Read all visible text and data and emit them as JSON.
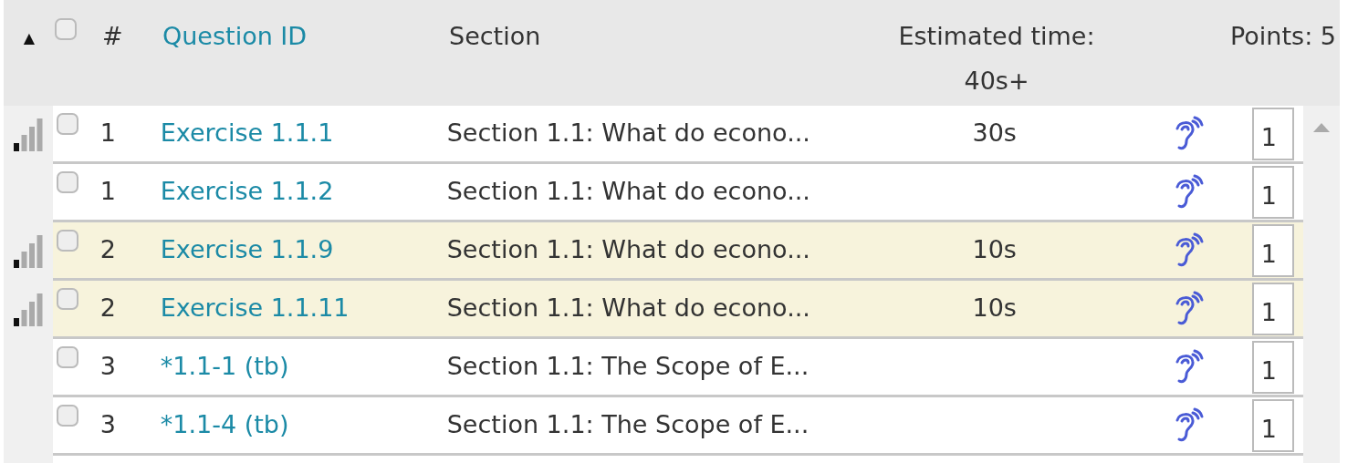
{
  "header": {
    "sort_indicator": "▲",
    "select_all_checked": false,
    "number": "#",
    "question_id": "Question ID",
    "section": "Section",
    "estimated_time": "Estimated time:",
    "estimated_total": "40s+",
    "points": "Points: 5"
  },
  "rows": [
    {
      "level": 0.25,
      "checked": false,
      "number": "1",
      "question_id": "Exercise 1.1.1",
      "section": "Section 1.1: What do econo...",
      "time": "30s",
      "points": "1",
      "highlighted": false
    },
    {
      "checked": false,
      "number": "1",
      "question_id": "Exercise 1.1.2",
      "section": "Section 1.1: What do econo...",
      "points": "1",
      "highlighted": false
    },
    {
      "level": 0.25,
      "checked": false,
      "number": "2",
      "question_id": "Exercise 1.1.9",
      "section": "Section 1.1: What do econo...",
      "time": "10s",
      "points": "1",
      "highlighted": true
    },
    {
      "level": 0.25,
      "checked": false,
      "number": "2",
      "question_id": "Exercise 1.1.11",
      "section": "Section 1.1: What do econo...",
      "time": "10s",
      "points": "1",
      "highlighted": true
    },
    {
      "checked": false,
      "number": "3",
      "question_id": "*1.1-1 (tb)",
      "section": "Section 1.1: The Scope of E...",
      "points": "1",
      "highlighted": false
    },
    {
      "checked": false,
      "number": "3",
      "question_id": "*1.1-4 (tb)",
      "section": "Section 1.1: The Scope of E...",
      "points": "1",
      "highlighted": false
    }
  ]
}
